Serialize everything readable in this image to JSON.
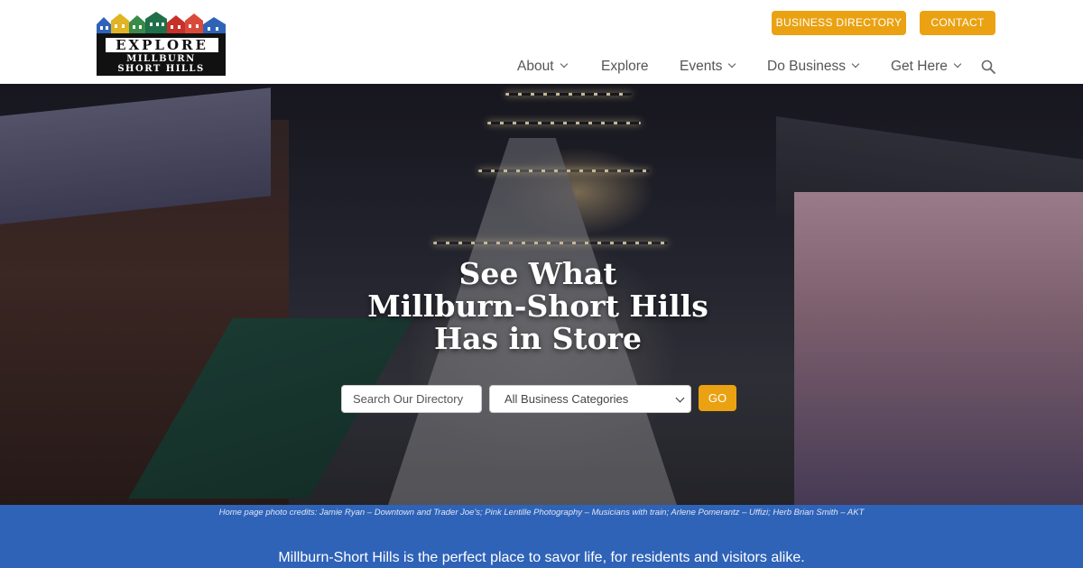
{
  "brand": {
    "logo_word": "EXPLORE",
    "logo_line1": "MILLBURN",
    "logo_line2": "SHORT HILLS",
    "colors": {
      "accent": "#eaa212",
      "blue_band": "#2f63b8"
    }
  },
  "header": {
    "buttons": {
      "directory": "BUSINESS DIRECTORY",
      "contact": "CONTACT"
    },
    "nav": [
      {
        "label": "About",
        "has_dropdown": true
      },
      {
        "label": "Explore",
        "has_dropdown": false
      },
      {
        "label": "Events",
        "has_dropdown": true
      },
      {
        "label": "Do Business",
        "has_dropdown": true
      },
      {
        "label": "Get Here",
        "has_dropdown": true
      }
    ],
    "search_icon": "search-icon"
  },
  "hero": {
    "title_line1": "See What",
    "title_line2": "Millburn-Short Hills",
    "title_line3": "Has in Store",
    "search_placeholder": "Search Our Directory",
    "category_selected": "All Business Categories",
    "go_label": "GO"
  },
  "footer_band": {
    "credits": "Home page photo credits: Jamie Ryan – Downtown and Trader Joe's;  Pink Lentille Photography – Musicians with train;  Arlene Pomerantz – Uffizi;  Herb Brian Smith – AKT",
    "tagline": "Millburn-Short Hills is the perfect place to savor life, for residents and visitors alike."
  }
}
